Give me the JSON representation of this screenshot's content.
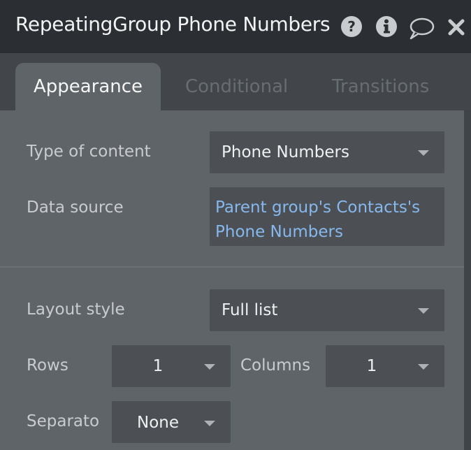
{
  "header": {
    "title": "RepeatingGroup Phone Numbers",
    "icons": [
      "help-icon",
      "info-icon",
      "comment-icon",
      "close-icon"
    ]
  },
  "tabs": [
    {
      "label": "Appearance",
      "active": true
    },
    {
      "label": "Conditional",
      "active": false
    },
    {
      "label": "Transitions",
      "active": false
    }
  ],
  "fields": {
    "type_of_content": {
      "label": "Type of content",
      "value": "Phone Numbers"
    },
    "data_source": {
      "label": "Data source",
      "value_line1": "Parent group's Contacts's",
      "value_line2": "Phone Numbers"
    },
    "layout_style": {
      "label": "Layout style",
      "value": "Full list"
    },
    "rows": {
      "label": "Rows",
      "value": "1"
    },
    "columns": {
      "label": "Columns",
      "value": "1"
    },
    "separator": {
      "label": "Separato",
      "value": "None"
    }
  },
  "colors": {
    "panel": "#5f6468",
    "header": "#2b2f33",
    "dynamic_text": "#86b8ee"
  }
}
